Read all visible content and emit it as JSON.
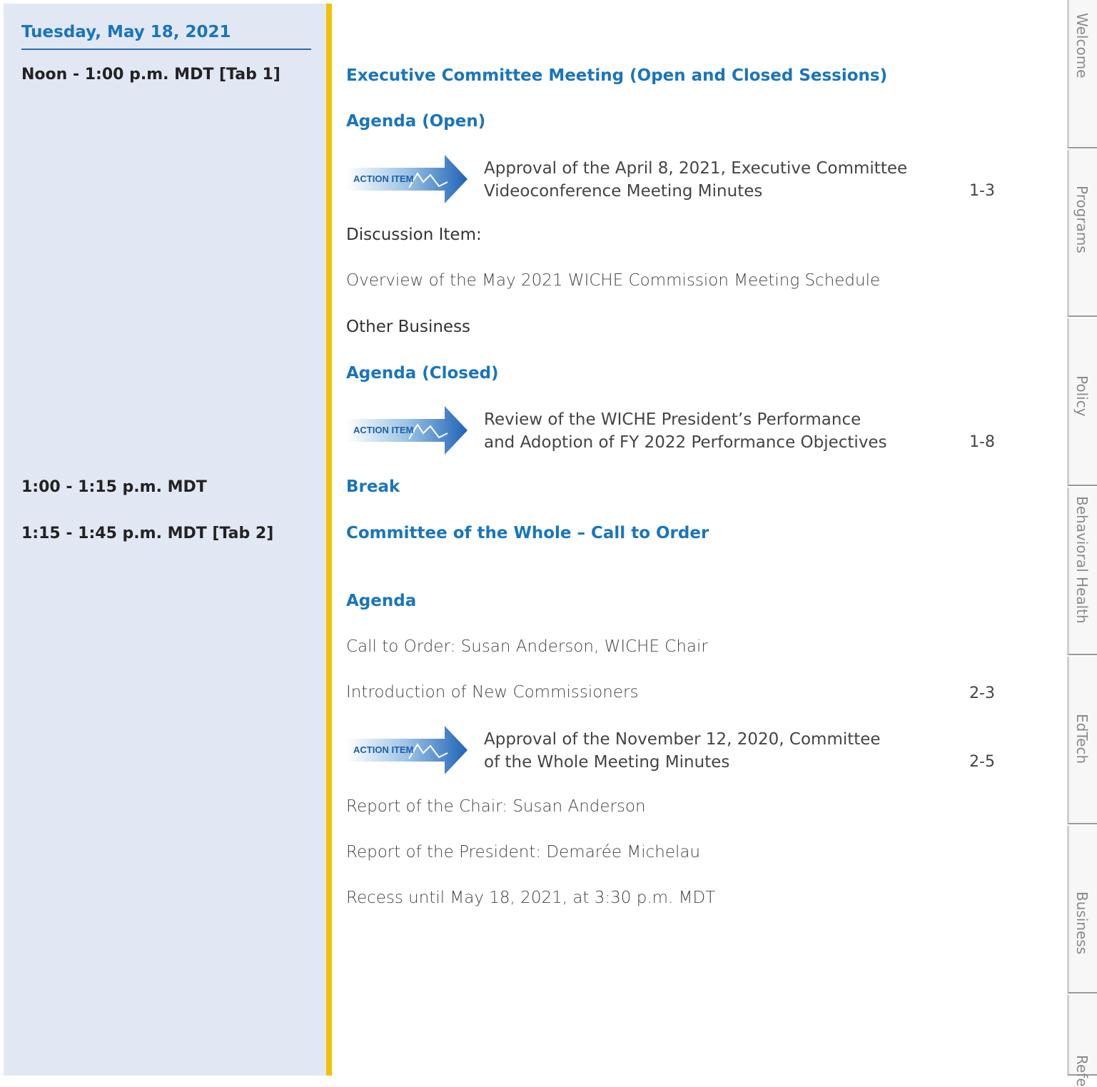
{
  "sidebar": {
    "date": "Tuesday, May 18, 2021",
    "times": [
      "Noon - 1:00 p.m. MDT [Tab 1]",
      "1:00 - 1:15 p.m. MDT",
      "1:15 - 1:45 p.m. MDT [Tab 2]"
    ]
  },
  "exec": {
    "title": "Executive Committee Meeting (Open and Closed Sessions)",
    "agenda_open": "Agenda (Open)",
    "item1_line1": "Approval of the April 8, 2021, Executive Committee",
    "item1_line2": "Videoconference Meeting Minutes",
    "item1_page": "1-3",
    "discussion_label": "Discussion Item:",
    "discussion_text": "Overview of the May 2021 WICHE Commission Meeting Schedule",
    "other_business": "Other Business",
    "agenda_closed": "Agenda (Closed)",
    "item2_line1": "Review of the WICHE President’s Performance",
    "item2_line2": "and Adoption of FY 2022 Performance Objectives",
    "item2_page": "1-8"
  },
  "break_label": "Break",
  "cow": {
    "title": "Committee of the Whole – Call to Order",
    "agenda": "Agenda",
    "call_to_order": "Call to Order: Susan Anderson, WICHE Chair",
    "intro": "Introduction of New Commissioners",
    "intro_page": "2-3",
    "item_line1": "Approval of the November 12, 2020, Committee",
    "item_line2": "of the Whole Meeting Minutes",
    "item_page": "2-5",
    "chair_report": "Report of the Chair: Susan Anderson",
    "president_report": "Report of the President: Demarée Michelau",
    "recess": "Recess until May 18, 2021, at 3:30 p.m. MDT"
  },
  "action_label": "ACTION ITEM",
  "tabs": [
    "Welcome",
    "Programs",
    "Policy",
    "Behavioral Health",
    "EdTech",
    "Business",
    "Refe"
  ]
}
